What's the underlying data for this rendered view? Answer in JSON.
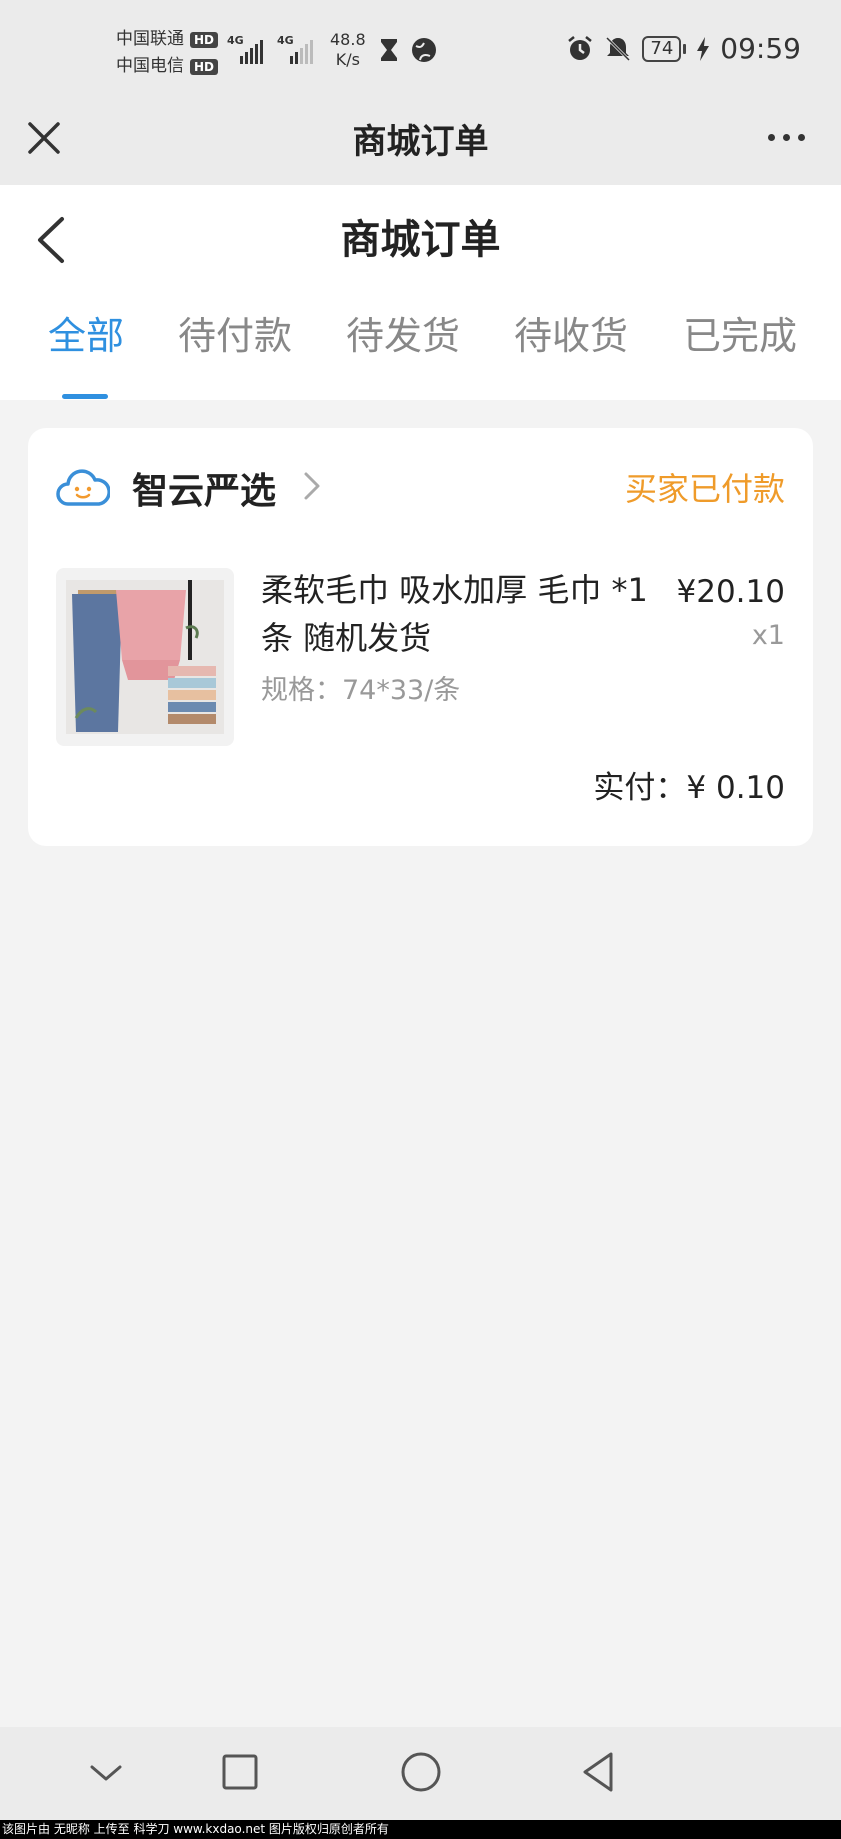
{
  "status_bar": {
    "carrier1": "中国联通",
    "carrier2": "中国电信",
    "hd_badge": "HD",
    "network1": "4G",
    "network2": "4G",
    "speed_value": "48.8",
    "speed_unit": "K/s",
    "battery": "74",
    "time": "09:59",
    "icons": [
      "hourglass-icon",
      "globe-icon",
      "alarm-icon",
      "mute-icon",
      "charging-icon"
    ]
  },
  "titlebar": {
    "title": "商城订单",
    "close_icon": "close-icon",
    "more_icon": "more-icon"
  },
  "header": {
    "title": "商城订单",
    "back_icon": "back-icon"
  },
  "tabs": [
    {
      "label": "全部",
      "active": true
    },
    {
      "label": "待付款",
      "active": false
    },
    {
      "label": "待发货",
      "active": false
    },
    {
      "label": "待收货",
      "active": false
    },
    {
      "label": "已完成",
      "active": false
    }
  ],
  "colors": {
    "accent": "#2f90e0",
    "status_orange": "#ef9b2a",
    "background": "#f3f3f3"
  },
  "order": {
    "shop_name": "智云严选",
    "shop_icon": "cloud-smile-icon",
    "status": "买家已付款",
    "product_title": "柔软毛巾 吸水加厚 毛巾 *1条 随机发货",
    "spec": "规格：74*33/条",
    "price": "¥20.10",
    "quantity": "x1",
    "paid_label": "实付：",
    "paid_amount": "¥ 0.10"
  },
  "navbar": {
    "icons": [
      "nav-down-icon",
      "recent-apps-icon",
      "home-icon",
      "back-nav-icon"
    ]
  },
  "watermark": "该图片由 无昵称 上传至 科学刀 www.kxdao.net 图片版权归原创者所有"
}
